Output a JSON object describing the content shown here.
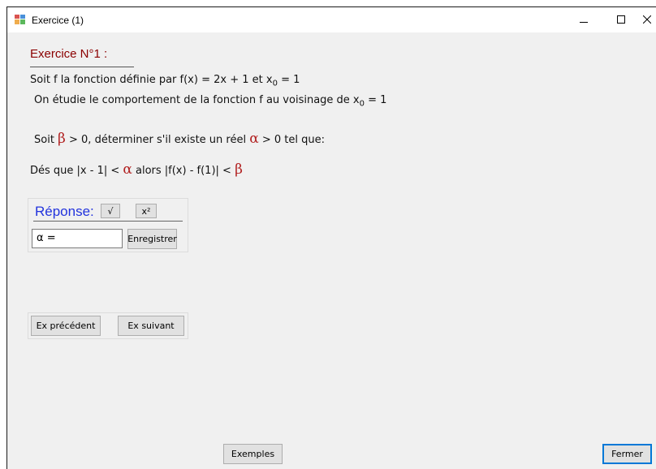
{
  "window": {
    "title": "Exercice (1)",
    "min_glyph": "–",
    "max_glyph": "☐",
    "close_glyph": "✕"
  },
  "exercise": {
    "heading": "Exercice N°1 :",
    "line1_a": "Soit f la fonction définie par f(x) = 2x + 1     et  x",
    "line1_sub": "0",
    "line1_b": " = 1",
    "line2_a": "On étudie le comportement de la fonction f au voisinage de x",
    "line2_sub": "0",
    "line2_b": " = 1",
    "line3_a": "Soit ",
    "beta": "β",
    "line3_b": " > 0, déterminer s'il existe un réel ",
    "alpha": "α",
    "line3_c": " > 0 tel que:",
    "line4_a": "Dés que |x - 1| < ",
    "line4_b": " alors  |f(x) - f(1)| < "
  },
  "answer": {
    "label": "Réponse:",
    "sqrt_label": "√",
    "square_label": "x²",
    "input_value": "α =",
    "save_label": "Enregistrer"
  },
  "nav": {
    "prev_label": "Ex précédent",
    "next_label": "Ex suivant"
  },
  "footer": {
    "examples_label": "Exemples",
    "close_label": "Fermer"
  }
}
